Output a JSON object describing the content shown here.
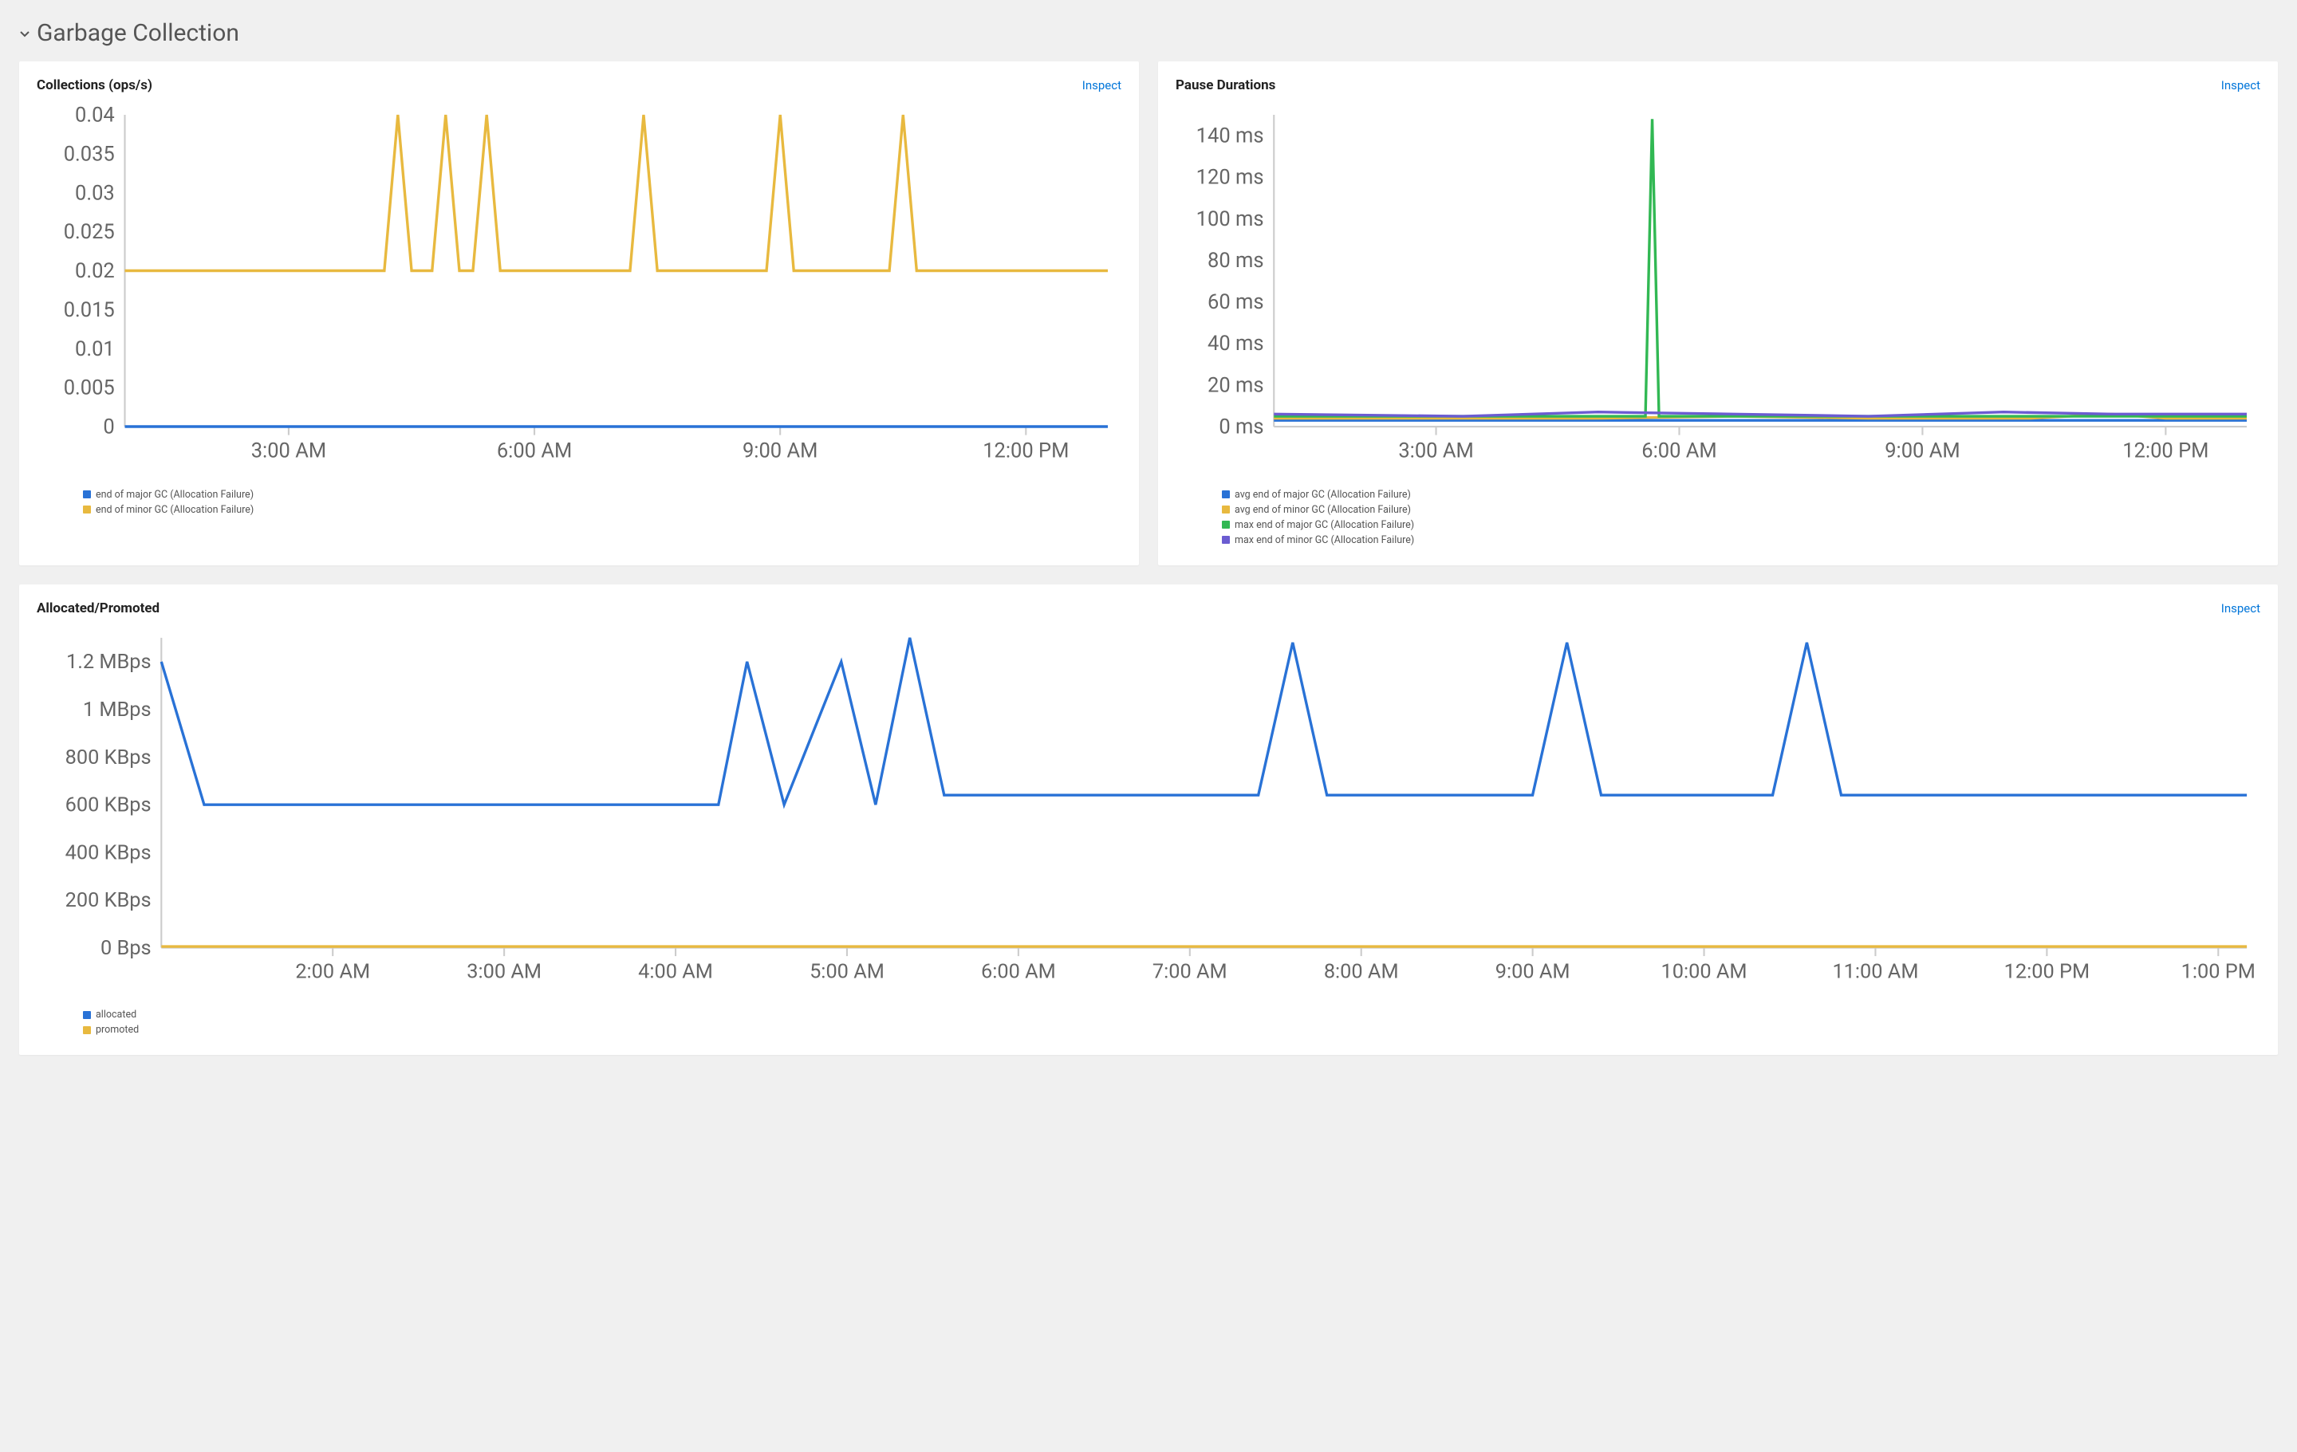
{
  "section": {
    "title": "Garbage Collection"
  },
  "inspect_label": "Inspect",
  "colors": {
    "blue": "#2972d6",
    "yellow": "#e8b93f",
    "green": "#31b853",
    "purple": "#6b5cd1"
  },
  "cards": {
    "collections": {
      "title": "Collections (ops/s)",
      "chart_data": {
        "type": "line",
        "xlabel": "",
        "ylabel": "",
        "ylim": [
          0,
          0.04
        ],
        "y_ticks": [
          "0",
          "0.005",
          "0.01",
          "0.015",
          "0.02",
          "0.025",
          "0.03",
          "0.035",
          "0.04"
        ],
        "x_ticks": [
          "3:00 AM",
          "6:00 AM",
          "9:00 AM",
          "12:00 PM"
        ],
        "x_domain_minutes": [
          60,
          780
        ],
        "x_tick_minutes": [
          180,
          360,
          540,
          720
        ],
        "series": [
          {
            "name": "end of major GC (Allocation Failure)",
            "color_key": "blue",
            "points": [
              [
                60,
                0
              ],
              [
                780,
                0
              ]
            ]
          },
          {
            "name": "end of minor GC (Allocation Failure)",
            "color_key": "yellow",
            "points": [
              [
                60,
                0.02
              ],
              [
                250,
                0.02
              ],
              [
                260,
                0.04
              ],
              [
                270,
                0.02
              ],
              [
                285,
                0.02
              ],
              [
                295,
                0.04
              ],
              [
                305,
                0.02
              ],
              [
                315,
                0.02
              ],
              [
                325,
                0.04
              ],
              [
                335,
                0.02
              ],
              [
                430,
                0.02
              ],
              [
                440,
                0.04
              ],
              [
                450,
                0.02
              ],
              [
                530,
                0.02
              ],
              [
                540,
                0.04
              ],
              [
                550,
                0.02
              ],
              [
                620,
                0.02
              ],
              [
                630,
                0.04
              ],
              [
                640,
                0.02
              ],
              [
                780,
                0.02
              ]
            ]
          }
        ]
      }
    },
    "pause": {
      "title": "Pause Durations",
      "chart_data": {
        "type": "line",
        "xlabel": "",
        "ylabel": "",
        "ylim": [
          0,
          150
        ],
        "y_ticks": [
          "0 ms",
          "20 ms",
          "40 ms",
          "60 ms",
          "80 ms",
          "100 ms",
          "120 ms",
          "140 ms"
        ],
        "y_tick_vals": [
          0,
          20,
          40,
          60,
          80,
          100,
          120,
          140
        ],
        "x_ticks": [
          "3:00 AM",
          "6:00 AM",
          "9:00 AM",
          "12:00 PM"
        ],
        "x_domain_minutes": [
          60,
          780
        ],
        "x_tick_minutes": [
          180,
          360,
          540,
          720
        ],
        "series": [
          {
            "name": "avg end of major GC (Allocation Failure)",
            "color_key": "blue",
            "points": [
              [
                60,
                3
              ],
              [
                780,
                3
              ]
            ]
          },
          {
            "name": "avg end of minor GC (Allocation Failure)",
            "color_key": "yellow",
            "points": [
              [
                60,
                4
              ],
              [
                300,
                4
              ],
              [
                400,
                5
              ],
              [
                500,
                4
              ],
              [
                620,
                4
              ],
              [
                680,
                6
              ],
              [
                720,
                4
              ],
              [
                780,
                4
              ]
            ]
          },
          {
            "name": "max end of major GC (Allocation Failure)",
            "color_key": "green",
            "points": [
              [
                60,
                5
              ],
              [
                335,
                5
              ],
              [
                340,
                148
              ],
              [
                345,
                5
              ],
              [
                780,
                5
              ]
            ]
          },
          {
            "name": "max end of minor GC (Allocation Failure)",
            "color_key": "purple",
            "points": [
              [
                60,
                6
              ],
              [
                200,
                5
              ],
              [
                300,
                7
              ],
              [
                400,
                6
              ],
              [
                500,
                5
              ],
              [
                600,
                7
              ],
              [
                680,
                6
              ],
              [
                780,
                6
              ]
            ]
          }
        ]
      }
    },
    "alloc": {
      "title": "Allocated/Promoted",
      "chart_data": {
        "type": "line",
        "xlabel": "",
        "ylabel": "",
        "ylim": [
          0,
          1300000
        ],
        "y_ticks": [
          "0 Bps",
          "200 KBps",
          "400 KBps",
          "600 KBps",
          "800 KBps",
          "1 MBps",
          "1.2 MBps"
        ],
        "y_tick_vals": [
          0,
          200000,
          400000,
          600000,
          800000,
          1000000,
          1200000
        ],
        "x_ticks": [
          "2:00 AM",
          "3:00 AM",
          "4:00 AM",
          "5:00 AM",
          "6:00 AM",
          "7:00 AM",
          "8:00 AM",
          "9:00 AM",
          "10:00 AM",
          "11:00 AM",
          "12:00 PM",
          "1:00 PM"
        ],
        "x_domain_minutes": [
          60,
          790
        ],
        "x_tick_minutes": [
          120,
          180,
          240,
          300,
          360,
          420,
          480,
          540,
          600,
          660,
          720,
          780
        ],
        "series": [
          {
            "name": "allocated",
            "color_key": "blue",
            "points": [
              [
                60,
                1200000
              ],
              [
                75,
                600000
              ],
              [
                255,
                600000
              ],
              [
                265,
                1200000
              ],
              [
                278,
                600000
              ],
              [
                298,
                1200000
              ],
              [
                310,
                600000
              ],
              [
                322,
                1300000
              ],
              [
                334,
                640000
              ],
              [
                444,
                640000
              ],
              [
                456,
                1280000
              ],
              [
                468,
                640000
              ],
              [
                540,
                640000
              ],
              [
                552,
                1280000
              ],
              [
                564,
                640000
              ],
              [
                624,
                640000
              ],
              [
                636,
                1280000
              ],
              [
                648,
                640000
              ],
              [
                790,
                640000
              ]
            ]
          },
          {
            "name": "promoted",
            "color_key": "yellow",
            "points": [
              [
                60,
                5000
              ],
              [
                790,
                5000
              ]
            ]
          }
        ]
      }
    }
  },
  "chart_data": [
    {
      "ref": "cards.collections.chart_data"
    },
    {
      "ref": "cards.pause.chart_data"
    },
    {
      "ref": "cards.alloc.chart_data"
    }
  ]
}
